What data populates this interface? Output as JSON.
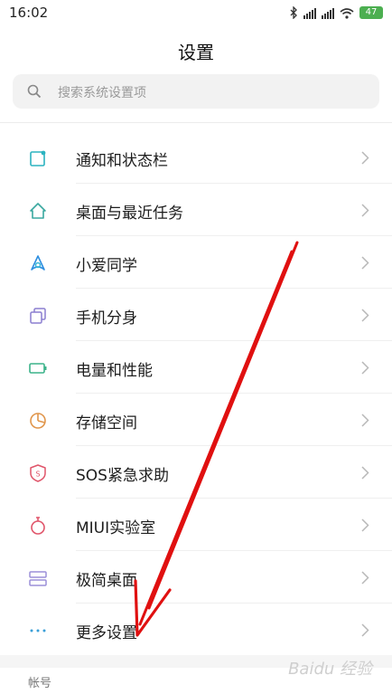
{
  "status": {
    "time": "16:02",
    "battery": "47",
    "icons": [
      "bluetooth-icon",
      "signal-icon",
      "signal-icon",
      "wifi-icon",
      "battery-icon"
    ]
  },
  "page": {
    "title": "设置"
  },
  "search": {
    "placeholder": "搜索系统设置项"
  },
  "items": [
    {
      "label": "通知和状态栏",
      "icon": "notification-icon",
      "color": "#2bb3c0"
    },
    {
      "label": "桌面与最近任务",
      "icon": "home-icon",
      "color": "#3aa8a0"
    },
    {
      "label": "小爱同学",
      "icon": "xiaoai-icon",
      "color": "#2f8fe0"
    },
    {
      "label": "手机分身",
      "icon": "dual-phone-icon",
      "color": "#8b7fd0"
    },
    {
      "label": "电量和性能",
      "icon": "battery-icon",
      "color": "#3cb38a"
    },
    {
      "label": "存储空间",
      "icon": "storage-icon",
      "color": "#e0954a"
    },
    {
      "label": "SOS紧急求助",
      "icon": "sos-icon",
      "color": "#e0556a"
    },
    {
      "label": "MIUI实验室",
      "icon": "lab-flask-icon",
      "color": "#e0556a"
    },
    {
      "label": "极简桌面",
      "icon": "simple-desktop-icon",
      "color": "#9b8fd8"
    },
    {
      "label": "更多设置",
      "icon": "more-dots-icon",
      "color": "#3a9fd8"
    }
  ],
  "section": {
    "label": "帐号"
  },
  "watermark": "Baidu 经验",
  "annotation": {
    "color": "#e01010"
  }
}
